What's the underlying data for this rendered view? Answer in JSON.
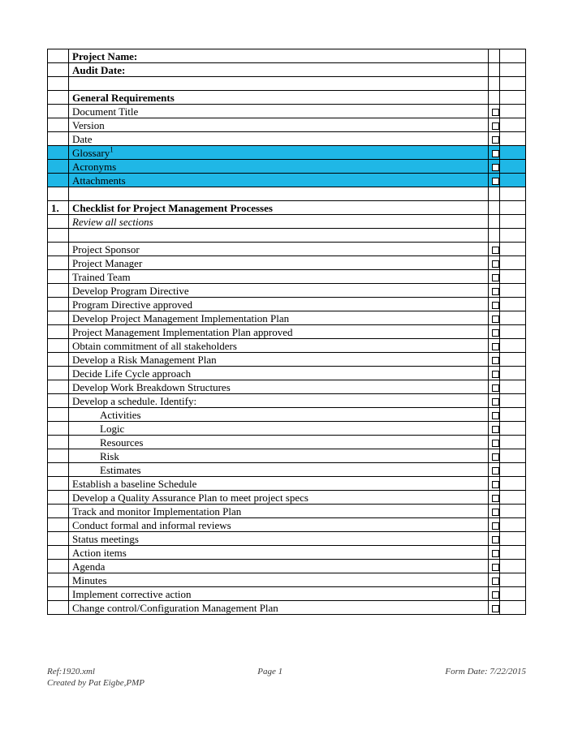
{
  "header": {
    "projectNameLabel": "Project Name:",
    "auditDateLabel": "Audit Date:"
  },
  "general": {
    "heading": "General Requirements",
    "items": [
      {
        "label": "Document Title",
        "highlight": false
      },
      {
        "label": "Version",
        "highlight": false
      },
      {
        "label": "Date",
        "highlight": false
      },
      {
        "label": "Glossary",
        "highlight": true,
        "sup": "1"
      },
      {
        "label": "Acronyms",
        "highlight": true
      },
      {
        "label": "Attachments",
        "highlight": true
      }
    ]
  },
  "section1": {
    "number": "1.",
    "heading": "Checklist for Project Management Processes",
    "subheading": "Review all sections",
    "items": [
      {
        "label": "Project Sponsor"
      },
      {
        "label": "Project Manager"
      },
      {
        "label": "Trained Team"
      },
      {
        "label": "Develop Program Directive"
      },
      {
        "label": "Program Directive approved"
      },
      {
        "label": "Develop Project Management Implementation Plan"
      },
      {
        "label": "Project Management Implementation Plan approved"
      },
      {
        "label": "Obtain commitment of all stakeholders"
      },
      {
        "label": "Develop a Risk Management Plan"
      },
      {
        "label": "Decide Life Cycle approach"
      },
      {
        "label": "Develop Work Breakdown Structures"
      },
      {
        "label": "Develop a schedule.  Identify:"
      },
      {
        "label": "Activities",
        "indent": true
      },
      {
        "label": "Logic",
        "indent": true
      },
      {
        "label": "Resources",
        "indent": true
      },
      {
        "label": "Risk",
        "indent": true
      },
      {
        "label": "Estimates",
        "indent": true
      },
      {
        "label": "Establish a baseline Schedule"
      },
      {
        "label": "Develop a Quality Assurance Plan to meet project specs"
      },
      {
        "label": "Track and monitor Implementation Plan"
      },
      {
        "label": "Conduct formal and informal reviews"
      },
      {
        "label": "Status meetings"
      },
      {
        "label": "Action items"
      },
      {
        "label": "Agenda"
      },
      {
        "label": "Minutes"
      },
      {
        "label": "Implement corrective action"
      },
      {
        "label": "Change control/Configuration Management Plan"
      }
    ]
  },
  "footer": {
    "ref": "Ref:1920.xml",
    "page": "Page 1",
    "formDate": "Form Date: 7/22/2015",
    "createdBy": "Created by Pat Eigbe,PMP"
  }
}
